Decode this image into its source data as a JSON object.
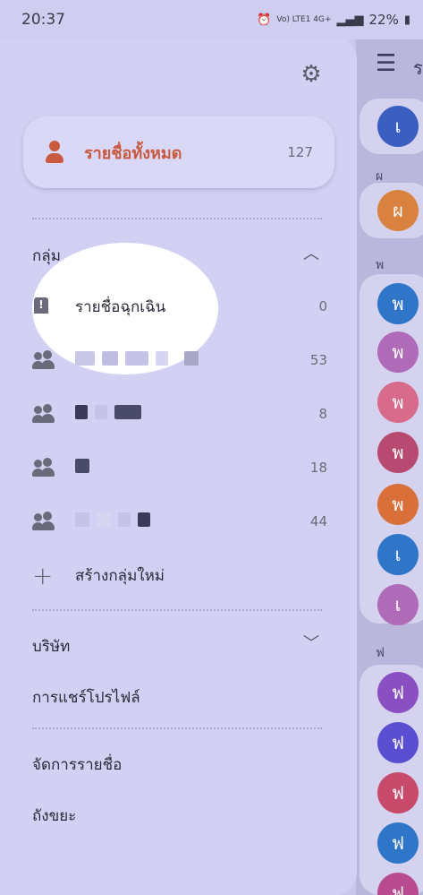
{
  "status_bar": {
    "time": "20:37",
    "icons": [
      "alarm-icon",
      "volte-icon",
      "signal-icon"
    ],
    "network": "Vo) LTE1 4G+",
    "battery": "22%"
  },
  "drawer": {
    "all_contacts": {
      "label": "รายชื่อทั้งหมด",
      "count": "127"
    },
    "groups_section": {
      "title": "กลุ่ม"
    },
    "groups": [
      {
        "label": "รายชื่อฉุกเฉิน",
        "count": "0",
        "icon": "emergency-icon"
      },
      {
        "label": "",
        "count": "53",
        "icon": "group-icon"
      },
      {
        "label": "",
        "count": "8",
        "icon": "group-icon"
      },
      {
        "label": "",
        "count": "18",
        "icon": "group-icon"
      },
      {
        "label": "",
        "count": "44",
        "icon": "group-icon"
      }
    ],
    "create_group": "สร้างกลุ่มใหม่",
    "company_section": "บริษัท",
    "share_profile": "การแชร์โปรไฟล์",
    "manage_contacts": "จัดการรายชื่อ",
    "trash": "ถังขยะ"
  },
  "background": {
    "menu_icon": "☰",
    "header_letter": "ร",
    "sections": [
      "ผ",
      "พ",
      "ฟ"
    ],
    "avatars": [
      {
        "letter": "เ",
        "color": "#3a5fc0"
      },
      {
        "letter": "ผ",
        "color": "#d9823f"
      },
      {
        "letter": "พ",
        "color": "#2f75c8"
      },
      {
        "letter": "พ",
        "color": "#b06bb8"
      },
      {
        "letter": "พ",
        "color": "#d86a8c"
      },
      {
        "letter": "พ",
        "color": "#b84a72"
      },
      {
        "letter": "พ",
        "color": "#d9703a"
      },
      {
        "letter": "เ",
        "color": "#2f75c8"
      },
      {
        "letter": "เ",
        "color": "#b06bb8"
      },
      {
        "letter": "ฟ",
        "color": "#8a4fc0"
      },
      {
        "letter": "ฟ",
        "color": "#5a4fd0"
      },
      {
        "letter": "ฟ",
        "color": "#c84a6a"
      },
      {
        "letter": "ฟ",
        "color": "#2f75c8"
      },
      {
        "letter": "ฟ",
        "color": "#b84a90"
      }
    ]
  }
}
